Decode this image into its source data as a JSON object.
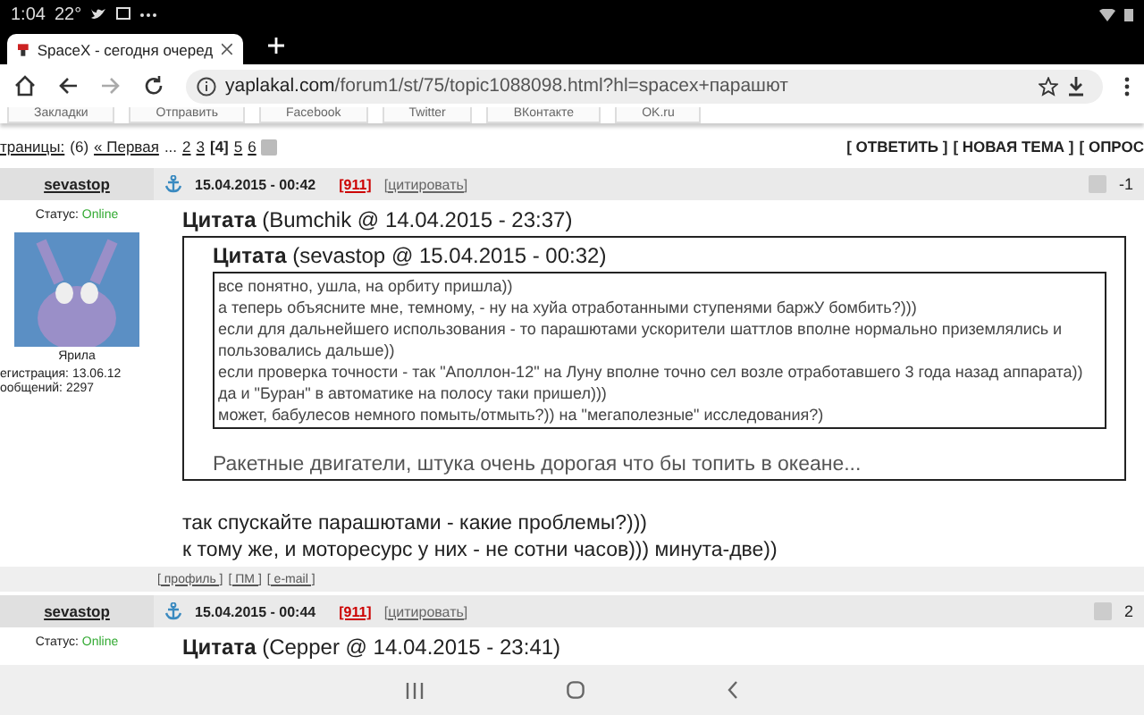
{
  "status_bar": {
    "time": "1:04",
    "temperature": "22°"
  },
  "browser": {
    "tab_title": "SpaceX - сегодня очеред",
    "url_host": "yaplakal.com",
    "url_path": "/forum1/st/75/topic1088098.html?hl=spacex+парашют"
  },
  "bookmarks": [
    "Закладки",
    "Отправить",
    "Facebook",
    "Twitter",
    "ВКонтакте",
    "OK.ru"
  ],
  "pagination": {
    "label": "траницы:",
    "count": "(6)",
    "first": "« Первая",
    "ellipsis": "...",
    "pages": [
      {
        "label": "2",
        "selected": false
      },
      {
        "label": "3",
        "selected": false
      },
      {
        "label": "[4]",
        "selected": true
      },
      {
        "label": "5",
        "selected": false
      },
      {
        "label": "6",
        "selected": false
      }
    ]
  },
  "actions": [
    "[ ОТВЕТИТЬ ]",
    "[ НОВАЯ ТЕМА ]",
    "[ ОПРОС"
  ],
  "posts": [
    {
      "author": "sevastop",
      "date": "15.04.2015 - 00:42",
      "rating": "[911]",
      "quote_link": "[цитировать]",
      "score": "-1",
      "status_label": "Статус:",
      "status": "Online",
      "rank": "Ярила",
      "registration": "егистрация: 13.06.12",
      "messages": "ообщений: 2297",
      "quote_title": "Цитата",
      "quote_meta": "(Bumchik @ 14.04.2015 - 23:37)",
      "inner_quote_title": "Цитата",
      "inner_quote_meta": "(sevastop @ 15.04.2015 - 00:32)",
      "inner_lines": [
        "все понятно, ушла, на орбиту пришла))",
        "а теперь объясните мне, темному, - ну на хуйа отработанными ступенями баржУ бомбить?)))",
        "если для дальнейшего использования - то парашютами ускорители шаттлов вполне нормально приземлялись и пользовались дальше))",
        "если проверка точности - так \"Аполлон-12\" на Луну вполне точно сел возле отработавшего 3 года назад аппарата)) да и \"Буран\" в автоматике на полосу таки пришел)))",
        "может, бабулесов немного помыть/отмыть?)) на \"мегаполезные\" исследования?)"
      ],
      "quote_text": "Ракетные двигатели, штука очень дорогая что бы топить в океане...",
      "body_lines": [
        "так спускайте парашютами - какие проблемы?)))",
        "к тому же, и моторесурс у них - не сотни часов))) минута-две))"
      ],
      "footer_links": [
        "[ профиль ]",
        "[ ПМ ]",
        "[ e-mail ]"
      ]
    },
    {
      "author": "sevastop",
      "date": "15.04.2015 - 00:44",
      "rating": "[911]",
      "quote_link": "[цитировать]",
      "score": "2",
      "status_label": "Статус:",
      "status": "Online",
      "quote_title": "Цитата",
      "quote_meta": "(Cepper @ 14.04.2015 - 23:41)"
    }
  ]
}
